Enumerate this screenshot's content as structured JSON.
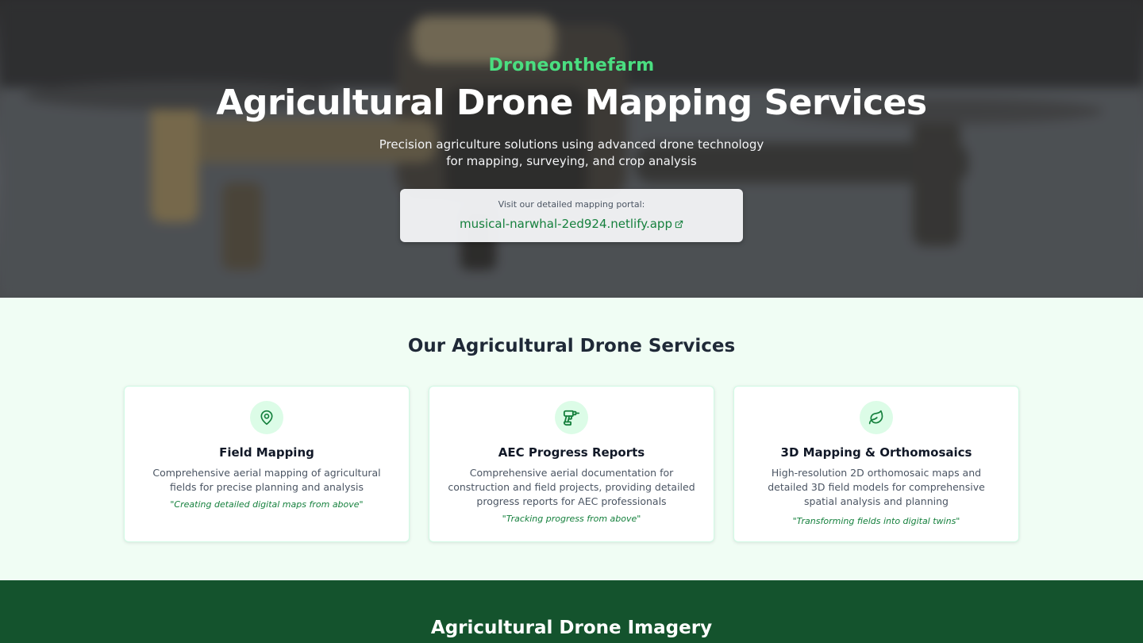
{
  "hero": {
    "brand": "Droneonthefarm",
    "title": "Agricultural Drone Mapping Services",
    "subtitle": "Precision agriculture solutions using advanced drone technology for mapping, surveying, and crop analysis",
    "portal": {
      "label": "Visit our detailed mapping portal:",
      "link_text": "musical-narwhal-2ed924.netlify.app",
      "link_icon": "external-link-icon"
    }
  },
  "services": {
    "title": "Our Agricultural Drone Services",
    "cards": [
      {
        "icon": "map-pin-icon",
        "title": "Field Mapping",
        "description": "Comprehensive aerial mapping of agricultural fields for precise planning and analysis",
        "quote": "\"Creating detailed digital maps from above\""
      },
      {
        "icon": "drill-icon",
        "title": "AEC Progress Reports",
        "description": "Comprehensive aerial documentation for construction and field projects, providing detailed progress reports for AEC professionals",
        "quote": "\"Tracking progress from above\""
      },
      {
        "icon": "leaf-icon",
        "title": "3D Mapping & Orthomosaics",
        "description": "High-resolution 2D orthomosaic maps and detailed 3D field models for comprehensive spatial analysis and planning",
        "quote": "\"Transforming fields into digital twins\""
      }
    ]
  },
  "imagery": {
    "title": "Agricultural Drone Imagery"
  },
  "colors": {
    "accent_green": "#4ade80",
    "link_green": "#15803d",
    "section_bg": "#f0fdf4",
    "footer_band": "#14532d"
  }
}
